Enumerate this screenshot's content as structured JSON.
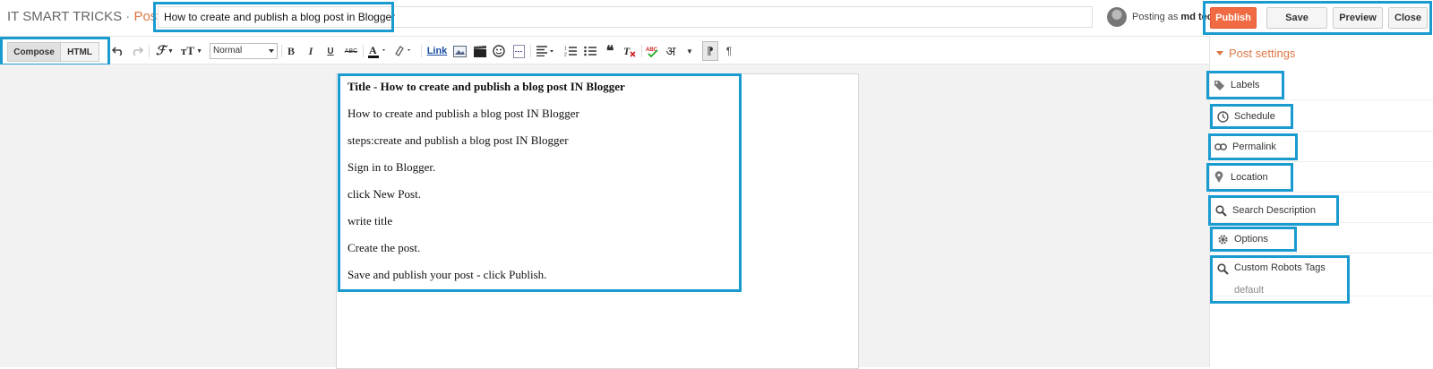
{
  "header": {
    "blog_name": "IT SMART TRICKS",
    "separator": " · ",
    "section": "Post",
    "post_title_value": "How to create and publish a blog post in Blogger",
    "posting_as_prefix": "Posting as ",
    "posting_as_user": "md tech",
    "buttons": {
      "publish": "Publish",
      "save": "Save",
      "preview": "Preview",
      "close": "Close"
    }
  },
  "toolbar": {
    "compose_label": "Compose",
    "html_label": "HTML",
    "font_size_value": "Normal",
    "bold": "B",
    "italic": "I",
    "underline": "U",
    "strikethrough": "ABC",
    "link_label": "Link",
    "input_tool": "अ"
  },
  "content": {
    "title_line": "Title - How to create and publish a blog post IN Blogger",
    "paragraphs": [
      "How to create and publish a blog post IN Blogger",
      "steps:create and publish a blog post IN Blogger",
      "Sign in to Blogger.",
      "click New Post.",
      "write title",
      "Create the post.",
      "Save and publish your post - click Publish."
    ]
  },
  "sidebar": {
    "header": "Post settings",
    "items": [
      {
        "label": "Labels",
        "icon": "tag-icon"
      },
      {
        "label": "Schedule",
        "icon": "clock-icon"
      },
      {
        "label": "Permalink",
        "icon": "link-icon"
      },
      {
        "label": "Location",
        "icon": "map-pin-icon"
      },
      {
        "label": "Search Description",
        "icon": "search-icon"
      },
      {
        "label": "Options",
        "icon": "gear-icon"
      },
      {
        "label": "Custom Robots Tags",
        "icon": "search-icon",
        "value": "default"
      }
    ]
  },
  "colors": {
    "accent": "#dd7744",
    "publish": "#f06b43",
    "highlight": "#1a9bd0"
  }
}
